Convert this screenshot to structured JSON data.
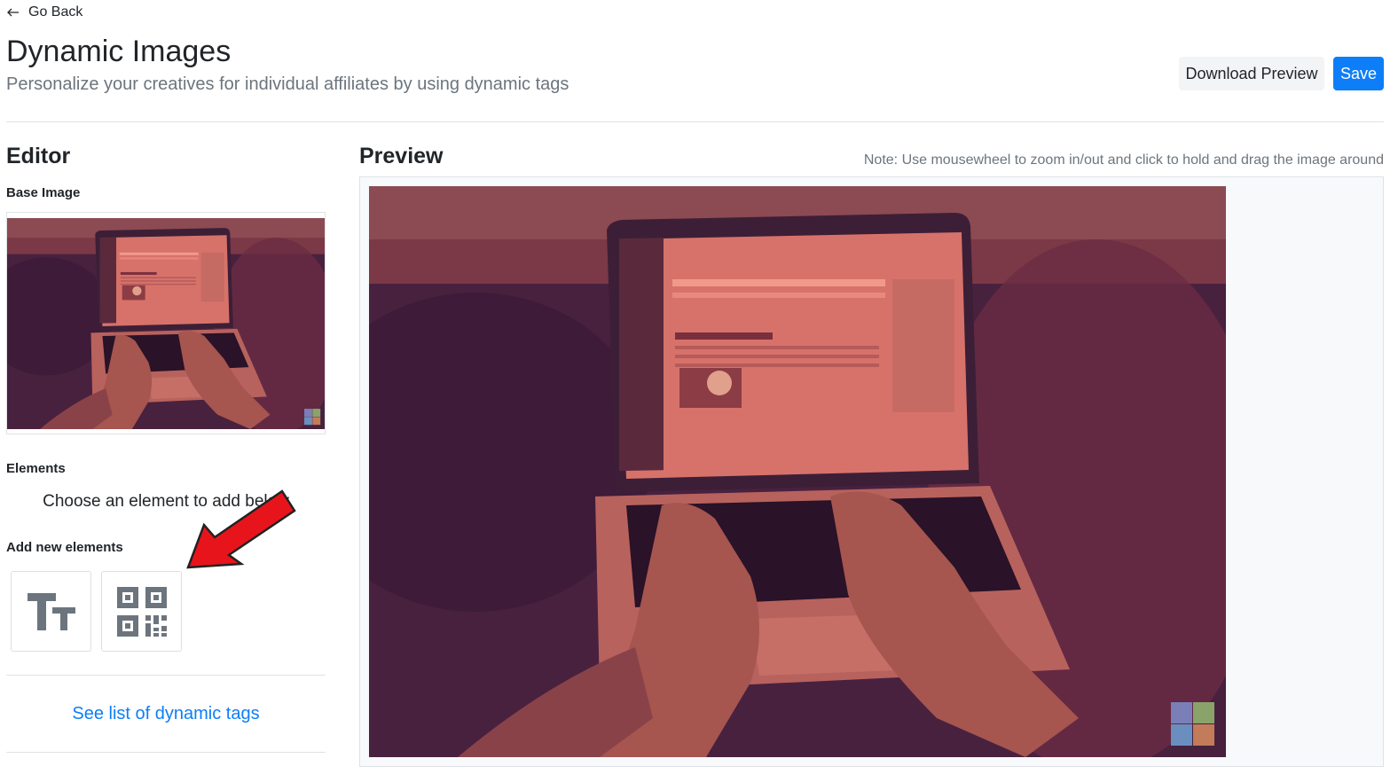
{
  "nav": {
    "back_label": "Go Back"
  },
  "header": {
    "title": "Dynamic Images",
    "subtitle": "Personalize your creatives for individual affiliates by using dynamic tags"
  },
  "actions": {
    "download_label": "Download Preview",
    "save_label": "Save"
  },
  "editor": {
    "heading": "Editor",
    "base_image_label": "Base Image",
    "elements_label": "Elements",
    "elements_empty": "Choose an element to add below",
    "add_new_label": "Add new elements",
    "tools": [
      {
        "name": "text-element",
        "icon": "text-size-icon"
      },
      {
        "name": "qr-code-element",
        "icon": "qr-code-icon"
      }
    ],
    "tags_link": "See list of dynamic tags"
  },
  "preview": {
    "heading": "Preview",
    "note": "Note: Use mousewheel to zoom in/out and click to hold and drag the image around",
    "image_subject": "laptop-typing-photo",
    "overlay_color": "#c2524f",
    "shadow_color": "#3f1f3d"
  },
  "colors": {
    "primary": "#0d7ef7",
    "secondary_bg": "#f3f4f5",
    "muted_text": "#6c757d"
  }
}
